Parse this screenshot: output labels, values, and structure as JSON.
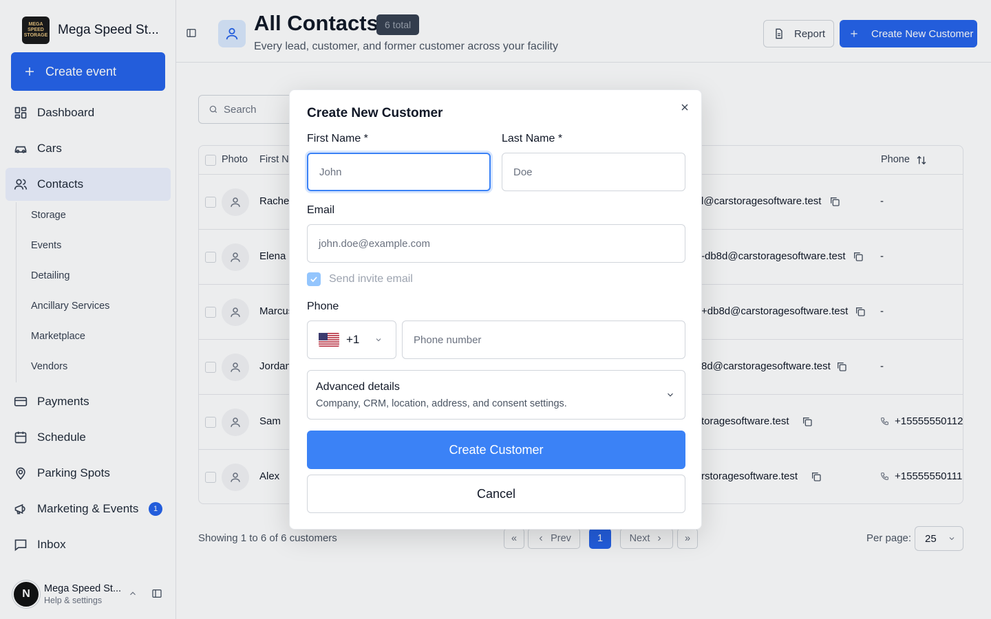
{
  "brand": {
    "name": "Mega Speed St...",
    "logo_text": "MEGA SPEED STORAGE"
  },
  "sidebar": {
    "create_event": "Create event",
    "items": [
      {
        "label": "Dashboard",
        "icon": "dashboard-icon"
      },
      {
        "label": "Cars",
        "icon": "car-icon"
      },
      {
        "label": "Contacts",
        "icon": "users-icon",
        "active": true
      },
      {
        "label": "Payments",
        "icon": "credit-card-icon"
      },
      {
        "label": "Schedule",
        "icon": "calendar-icon"
      },
      {
        "label": "Parking Spots",
        "icon": "map-pin-icon"
      },
      {
        "label": "Marketing & Events",
        "icon": "megaphone-icon",
        "badge": "1"
      },
      {
        "label": "Inbox",
        "icon": "message-icon"
      }
    ],
    "sub_items": [
      "Storage",
      "Events",
      "Detailing",
      "Ancillary Services",
      "Marketplace",
      "Vendors"
    ],
    "user": {
      "initial": "N",
      "name": "Mega Speed St...",
      "sub": "Help & settings"
    }
  },
  "header": {
    "title": "All Contacts",
    "total_badge": "6 total",
    "subtitle": "Every lead, customer, and former customer across your facility",
    "report_label": "Report",
    "create_label": "Create New Customer"
  },
  "search": {
    "placeholder": "Search"
  },
  "table": {
    "columns": {
      "photo": "Photo",
      "first": "First N",
      "phone": "Phone"
    },
    "rows": [
      {
        "first": "Rachel",
        "email": "l@carstoragesoftware.test",
        "phone": "-"
      },
      {
        "first": "Elena",
        "email": "-db8d@carstoragesoftware.test",
        "phone": "-"
      },
      {
        "first": "Marcus",
        "email": "+db8d@carstoragesoftware.test",
        "phone": "-"
      },
      {
        "first": "Jordan",
        "email": "8d@carstoragesoftware.test",
        "phone": "-"
      },
      {
        "first": "Sam",
        "email": "toragesoftware.test",
        "phone": "+15555550112"
      },
      {
        "first": "Alex",
        "email": "rstoragesoftware.test",
        "phone": "+15555550111"
      }
    ]
  },
  "pagination": {
    "info": "Showing 1 to 6 of 6 customers",
    "first": "«",
    "prev": "Prev",
    "page": "1",
    "next": "Next",
    "last": "»",
    "per_page_label": "Per page:",
    "per_page_value": "25"
  },
  "modal": {
    "title": "Create New Customer",
    "first_name_label": "First Name *",
    "first_name_placeholder": "John",
    "last_name_label": "Last Name *",
    "last_name_placeholder": "Doe",
    "email_label": "Email",
    "email_placeholder": "john.doe@example.com",
    "invite_label": "Send invite email",
    "invite_checked": true,
    "phone_label": "Phone",
    "country_code": "+1",
    "phone_placeholder": "Phone number",
    "advanced_title": "Advanced details",
    "advanced_sub": "Company, CRM, location, address, and consent settings.",
    "submit_label": "Create Customer",
    "cancel_label": "Cancel"
  },
  "colors": {
    "primary": "#2563eb",
    "primary_light": "#3b82f6",
    "active_nav": "#eef2ff"
  }
}
